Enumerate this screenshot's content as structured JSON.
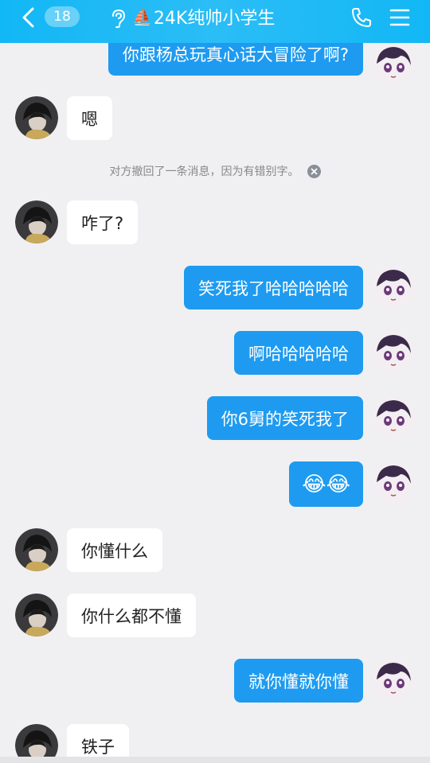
{
  "header": {
    "unread_count": "18",
    "boat_emoji": "⛵",
    "contact_name": "24K纯帅小学生"
  },
  "notice": {
    "text": "对方撤回了一条消息，因为有错别字。"
  },
  "messages": [
    {
      "side": "out",
      "text": "你跟杨总玩真心话大冒险了啊?"
    },
    {
      "side": "in",
      "text": "嗯"
    },
    {
      "side": "in",
      "text": "咋了?"
    },
    {
      "side": "out",
      "text": "笑死我了哈哈哈哈哈"
    },
    {
      "side": "out",
      "text": "啊哈哈哈哈哈"
    },
    {
      "side": "out",
      "text": "你6舅的笑死我了"
    },
    {
      "side": "out",
      "text": "😂😂"
    },
    {
      "side": "in",
      "text": "你懂什么"
    },
    {
      "side": "in",
      "text": "你什么都不懂"
    },
    {
      "side": "out",
      "text": "就你懂就你懂"
    },
    {
      "side": "in",
      "text": "铁子"
    }
  ],
  "colors": {
    "header_bg": "#12b7f5",
    "outgoing_bubble": "#1e9bf0",
    "incoming_bubble": "#ffffff",
    "chat_bg": "#f0f0f2"
  }
}
